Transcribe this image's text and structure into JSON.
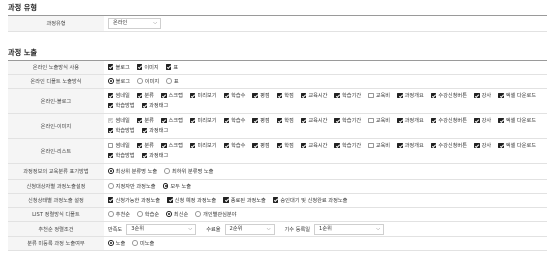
{
  "section_type": {
    "title": "과정 유형",
    "row_label": "과정유형",
    "select_value": "온라인"
  },
  "section_expose": {
    "title": "과정 노출",
    "rows": [
      {
        "label": "온라인 노출방식 사용",
        "checks": [
          {
            "label": "블로그",
            "state": "on"
          },
          {
            "label": "이미지",
            "state": "on"
          },
          {
            "label": "표",
            "state": "on"
          }
        ]
      },
      {
        "label": "온라인 디폴트 노출방식",
        "radios": [
          {
            "label": "블로그",
            "state": "on"
          },
          {
            "label": "이미지",
            "state": "off"
          },
          {
            "label": "표",
            "state": "off"
          }
        ]
      },
      {
        "label": "온라인-블로그",
        "line1": [
          {
            "label": "썸네일",
            "state": "on"
          },
          {
            "label": "분류",
            "state": "on"
          },
          {
            "label": "스크랩",
            "state": "on"
          },
          {
            "label": "미리보기",
            "state": "on"
          },
          {
            "label": "학습수",
            "state": "on"
          },
          {
            "label": "평점",
            "state": "on"
          },
          {
            "label": "학점",
            "state": "on"
          },
          {
            "label": "교육시간",
            "state": "on"
          },
          {
            "label": "학습기간",
            "state": "on"
          },
          {
            "label": "교육비",
            "state": "off"
          },
          {
            "label": "과정개요",
            "state": "on"
          },
          {
            "label": "수강신청버튼",
            "state": "on"
          },
          {
            "label": "강사",
            "state": "on"
          },
          {
            "label": "엑셀 다운로드",
            "state": "on"
          }
        ],
        "line2": [
          {
            "label": "학습방법",
            "state": "on"
          },
          {
            "label": "과정태그",
            "state": "on"
          }
        ]
      },
      {
        "label": "온라인-이미지",
        "line1": [
          {
            "label": "썸네일",
            "state": "dis"
          },
          {
            "label": "분류",
            "state": "on"
          },
          {
            "label": "스크랩",
            "state": "on"
          },
          {
            "label": "미리보기",
            "state": "on"
          },
          {
            "label": "학습수",
            "state": "on"
          },
          {
            "label": "평점",
            "state": "on"
          },
          {
            "label": "학점",
            "state": "on"
          },
          {
            "label": "교육시간",
            "state": "on"
          },
          {
            "label": "학습기간",
            "state": "on"
          },
          {
            "label": "교육비",
            "state": "off"
          },
          {
            "label": "과정개요",
            "state": "on"
          },
          {
            "label": "수강신청버튼",
            "state": "on"
          },
          {
            "label": "강사",
            "state": "on"
          },
          {
            "label": "엑셀 다운로드",
            "state": "on"
          }
        ],
        "line2": [
          {
            "label": "학습방법",
            "state": "on"
          },
          {
            "label": "과정태그",
            "state": "on"
          }
        ]
      },
      {
        "label": "온라인-리스트",
        "line1": [
          {
            "label": "썸네일",
            "state": "off"
          },
          {
            "label": "분류",
            "state": "on"
          },
          {
            "label": "스크랩",
            "state": "on"
          },
          {
            "label": "미리보기",
            "state": "on"
          },
          {
            "label": "학습수",
            "state": "on"
          },
          {
            "label": "평점",
            "state": "on"
          },
          {
            "label": "학점",
            "state": "on"
          },
          {
            "label": "교육시간",
            "state": "on"
          },
          {
            "label": "학습기간",
            "state": "on"
          },
          {
            "label": "교육비",
            "state": "off"
          },
          {
            "label": "과정개요",
            "state": "on"
          },
          {
            "label": "수강신청버튼",
            "state": "on"
          },
          {
            "label": "강사",
            "state": "on"
          },
          {
            "label": "엑셀 다운로드",
            "state": "on"
          }
        ],
        "line2": [
          {
            "label": "학습방법",
            "state": "on"
          },
          {
            "label": "과정태그",
            "state": "on"
          }
        ]
      },
      {
        "label": "과정정보의 교육분류 표기방법",
        "radios": [
          {
            "label": "최상위 분류명 노출",
            "state": "on"
          },
          {
            "label": "최하위 분류명 노출",
            "state": "off"
          }
        ]
      },
      {
        "label": "신청대상자별 과정노출설정",
        "radios": [
          {
            "label": "지정자만 과정노출",
            "state": "off"
          },
          {
            "label": "모두 노출",
            "state": "on"
          }
        ]
      },
      {
        "label": "신청상태별 과정노출 설정",
        "checks": [
          {
            "label": "신청가능한 과정노출",
            "state": "on"
          },
          {
            "label": "신청 예정 과정노출",
            "state": "on"
          },
          {
            "label": "종료된 과정노출",
            "state": "on"
          },
          {
            "label": "승인대기 및 신청완료 과정노출",
            "state": "on"
          }
        ]
      },
      {
        "label": "LIST 정렬방식 디폴트",
        "radios": [
          {
            "label": "추천순",
            "state": "off"
          },
          {
            "label": "학습순",
            "state": "off"
          },
          {
            "label": "최신순",
            "state": "on"
          },
          {
            "label": "개인별관심분야",
            "state": "off"
          }
        ]
      },
      {
        "label": "추천순 정렬조건",
        "selects": [
          {
            "label": "만족도",
            "value": "3순위"
          },
          {
            "label": "수료율",
            "value": "2순위"
          },
          {
            "label": "기수 등록일",
            "value": "1순위"
          }
        ]
      },
      {
        "label": "분류 미등록 과정 노출여부",
        "radios": [
          {
            "label": "노출",
            "state": "on"
          },
          {
            "label": "미노출",
            "state": "off"
          }
        ]
      }
    ]
  },
  "colors": {
    "label_bg": "#f5f5f5",
    "check_on": "#222222",
    "check_disabled": "#c8c8c8",
    "table_top_border": "#9a9a9a"
  },
  "icons": {
    "select_arrow": "chevron-down-icon"
  }
}
